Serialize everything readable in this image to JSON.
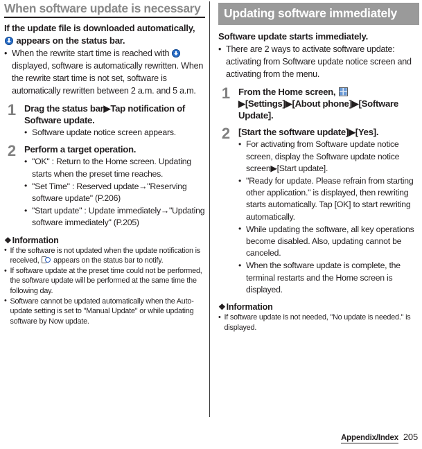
{
  "left": {
    "heading": "When software update is necessary",
    "lead_part1": "If the update file is downloaded automatically,",
    "lead_part2": "appears on the status bar.",
    "lead_icon": "download-circle-icon",
    "intro_bullet_part1": "When the rewrite start time is reached with",
    "intro_bullet_part2": "displayed, software is automatically rewritten. When the rewrite start time is not set, software is automatically rewritten between 2 a.m. and 5 a.m.",
    "steps": [
      {
        "num": "1",
        "title": "Drag the status bar▶Tap notification of Software update.",
        "bullets": [
          "Software update notice screen appears."
        ]
      },
      {
        "num": "2",
        "title": "Perform a target operation.",
        "bullets": [
          "\"OK\" : Return to the Home screen. Updating starts when the preset time reaches.",
          "\"Set Time\" : Reserved update→\"Reserving software update\" (P.206)",
          "\"Start update\" : Update immediately→\"Updating software immediately\" (P.205)"
        ]
      }
    ],
    "info": {
      "title": "Information",
      "diamond": "❖",
      "item1_part1": "If the software is not updated when the update notification is received,",
      "item1_icon": "notification-phone-icon",
      "item1_part2": "appears on the status bar to notify.",
      "items": [
        "If software update at the preset time could not be performed, the software update will be performed at the same time the following day.",
        "Software cannot be updated automatically when the Auto-update setting is set to \"Manual Update\" or while updating software by Now update."
      ]
    }
  },
  "right": {
    "heading": "Updating software immediately",
    "lead": "Software update starts immediately.",
    "intro_bullets": [
      "There are 2 ways to activate software update: activating from Software update notice screen and activating from the menu."
    ],
    "step1": {
      "num": "1",
      "title_part1": "From the Home screen,",
      "icon": "apps-grid-icon",
      "title_part2": "▶[Settings]▶[About phone]▶[Software Update]."
    },
    "step2": {
      "num": "2",
      "title": "[Start the software update]▶[Yes].",
      "bullets": [
        "For activating from Software update notice screen, display the Software update notice screen▶[Start update].",
        "\"Ready for update. Please refrain from starting other application.\" is displayed, then rewriting starts automatically. Tap [OK] to start rewriting automatically.",
        "While updating the software, all key operations become disabled. Also, updating cannot be canceled.",
        "When the software update is complete, the terminal restarts and the Home screen is displayed."
      ]
    },
    "info": {
      "title": "Information",
      "diamond": "❖",
      "items": [
        "If software update is not needed, \"No update is needed.\" is displayed."
      ]
    }
  },
  "footer": {
    "tab_label": "Appendix/Index",
    "page_number": "205"
  },
  "colors": {
    "heading_gray": "#8a8a8a",
    "band_gray": "#9a9a9a",
    "step_number_gray": "#808080",
    "icon_blue": "#2a6fc9",
    "text": "#231f20"
  }
}
